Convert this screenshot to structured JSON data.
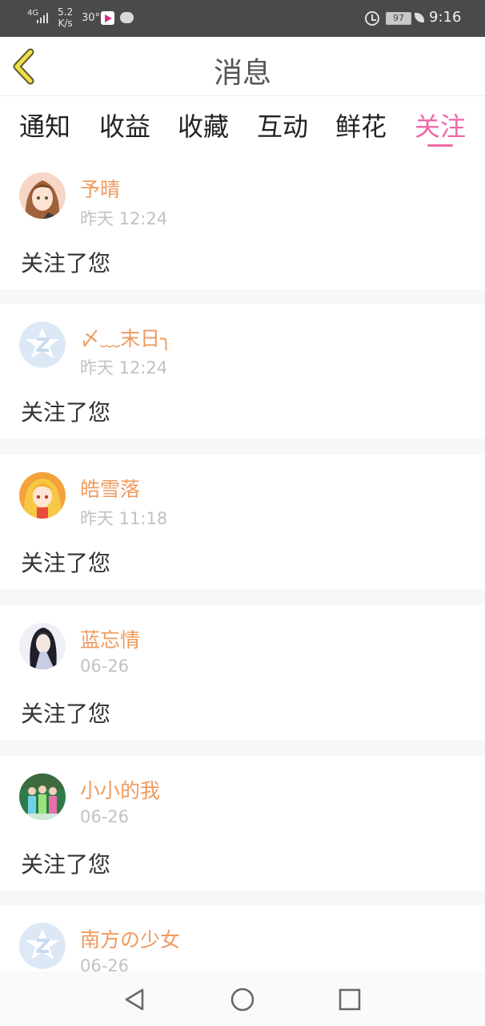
{
  "status_bar": {
    "network": "4G",
    "speed": "5.2\nK/s",
    "temperature": "30°",
    "battery": "97",
    "time": "9:16"
  },
  "header": {
    "title": "消息",
    "back_icon": "chevron-left-icon"
  },
  "tabs": [
    {
      "label": "通知",
      "active": false
    },
    {
      "label": "收益",
      "active": false
    },
    {
      "label": "收藏",
      "active": false
    },
    {
      "label": "互动",
      "active": false
    },
    {
      "label": "鲜花",
      "active": false
    },
    {
      "label": "关注",
      "active": true
    }
  ],
  "colors": {
    "accent": "#ee6aa7",
    "username": "#ef9a5e",
    "timestamp": "#c2c2c2"
  },
  "messages": [
    {
      "username": "予晴",
      "time": "昨天 12:24",
      "action": "关注了您",
      "avatar": "anime-girl-avatar"
    },
    {
      "username": "〆﹏末日╮",
      "time": "昨天 12:24",
      "action": "关注了您",
      "avatar": "default-qq-avatar"
    },
    {
      "username": "皓雪落",
      "time": "昨天 11:18",
      "action": "关注了您",
      "avatar": "anime-girl-avatar"
    },
    {
      "username": "蓝忘情",
      "time": "06-26",
      "action": "关注了您",
      "avatar": "anime-girl-avatar"
    },
    {
      "username": "小小的我",
      "time": "06-26",
      "action": "关注了您",
      "avatar": "group-photo-avatar"
    },
    {
      "username": "南方の少女",
      "time": "06-26",
      "action": "",
      "avatar": "default-qq-avatar"
    }
  ],
  "navbar": {
    "back": "triangle-back-icon",
    "home": "circle-home-icon",
    "recent": "square-recent-icon"
  }
}
